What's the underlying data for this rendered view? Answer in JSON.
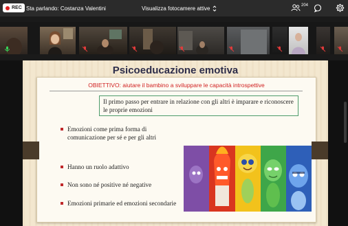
{
  "topbar": {
    "rec_label": "REC",
    "speaker": "Sta parlando: Costanza Valentini",
    "camera_view": "Visualizza fotocamere attive",
    "participants_count": "204"
  },
  "gallery": {
    "tile_count": 13
  },
  "slide": {
    "title": "Psicoeducazione emotiva",
    "objective": "OBIETTIVO: aiutare il bambino a sviluppare le capacità introspettive",
    "intro": "Il primo passo per entrare in relazione con gli altri è imparare e riconoscere le proprie emozioni",
    "bullets": [
      "Emozioni come prima forma di comunicazione per sé e per gli altri",
      "Hanno un ruolo adattivo",
      "Non sono né positive né negative",
      "Emozioni primarie ed emozioni secondarie"
    ],
    "image_colors": [
      "#7e4ea6",
      "#d9351f",
      "#f2c21c",
      "#3ea649",
      "#2e5fb8"
    ]
  },
  "colors": {
    "topbar_bg": "#2b2b2b",
    "objective_red": "#d01e1e",
    "box_border": "#4c9b6a",
    "bullet_red": "#c0282a"
  }
}
